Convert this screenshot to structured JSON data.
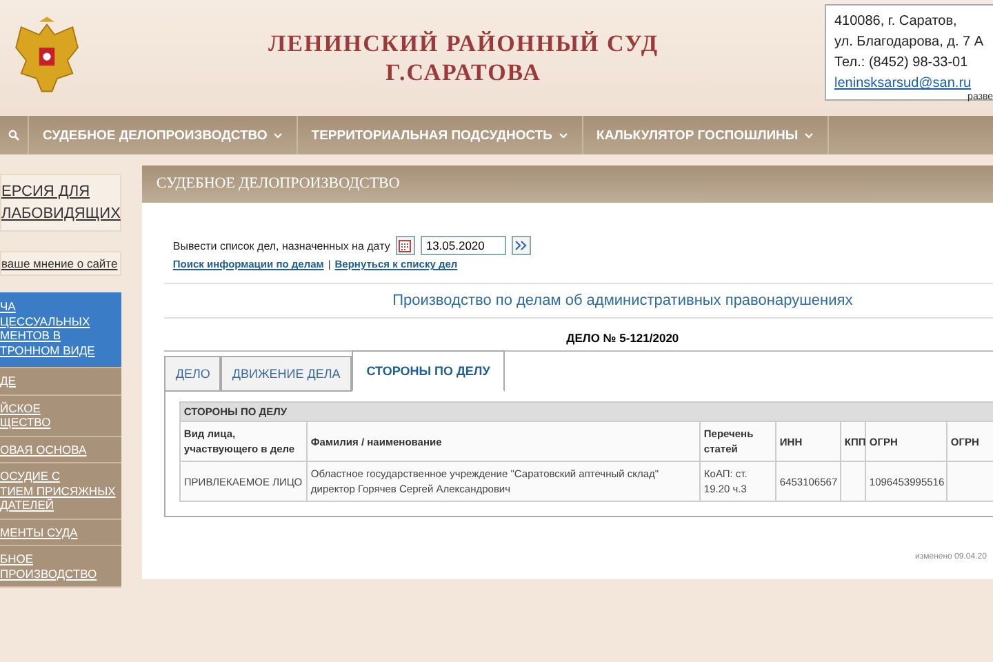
{
  "header": {
    "title_lines": [
      "ЛЕНИНСКИЙ РАЙОННЫЙ СУД",
      "Г.САРАТОВА"
    ],
    "contacts": [
      "410086, г. Саратов,",
      "ул. Благодарова, д. 7 А",
      "Тел.: (8452) 98-33-01"
    ],
    "email": "leninsksarsud@san.ru",
    "expand_hint": "разве"
  },
  "nav": {
    "items": [
      {
        "label": "СУДЕБНОЕ ДЕЛОПРОИЗВОДСТВО"
      },
      {
        "label": "ТЕРРИТОРИАЛЬНАЯ ПОДСУДНОСТЬ"
      },
      {
        "label": "КАЛЬКУЛЯТОР ГОСПОШЛИНЫ"
      }
    ]
  },
  "sidebar": {
    "accessibility_lines": [
      "ЕРСИЯ ДЛЯ",
      "ЛАБОВИДЯЩИХ"
    ],
    "feedback": "ваше мнение о сайте",
    "items": [
      {
        "lines": [
          "ЧА",
          "ЦЕССУАЛЬНЫХ",
          "МЕНТОВ В",
          "ТРОННОМ ВИДЕ"
        ],
        "selected": true
      },
      {
        "lines": [
          "ДЕ"
        ],
        "selected": false
      },
      {
        "lines": [
          "ЙСКОЕ",
          "ЩЕСТВО"
        ],
        "selected": false
      },
      {
        "lines": [
          "ОВАЯ ОСНОВА"
        ],
        "selected": false
      },
      {
        "lines": [
          "ОСУДИЕ С",
          "ТИЕМ ПРИСЯЖНЫХ",
          "ДАТЕЛЕЙ"
        ],
        "selected": false
      },
      {
        "lines": [
          "МЕНТЫ СУДА"
        ],
        "selected": false
      },
      {
        "lines": [
          "БНОЕ",
          "ПРОИЗВОДСТВО"
        ],
        "selected": false
      }
    ]
  },
  "panel": {
    "title": "СУДЕБНОЕ ДЕЛОПРОИЗВОДСТВО",
    "date_label": "Вывести список дел, назначенных на дату",
    "date_value": "13.05.2020",
    "links": [
      "Поиск информации по делам",
      "Вернуться к списку дел"
    ],
    "separator": "|",
    "category": "Производство по делам об административных правонарушениях",
    "case_title": "ДЕЛО № 5-121/2020",
    "tabs": [
      {
        "label": "ДЕЛО",
        "selected": false
      },
      {
        "label": "ДВИЖЕНИЕ ДЕЛА",
        "selected": false
      },
      {
        "label": "СТОРОНЫ ПО ДЕЛУ",
        "selected": true
      }
    ],
    "table": {
      "caption": "СТОРОНЫ ПО ДЕЛУ",
      "columns": [
        "Вид лица, участвующего в деле",
        "Фамилия / наименование",
        "Перечень статей",
        "ИНН",
        "КПП",
        "ОГРН",
        "ОГРН"
      ],
      "rows": [
        [
          "ПРИВЛЕКАЕМОЕ ЛИЦО",
          "Областное государственное учреждение \"Саратовский аптечный склад\" директор Горячев Сергей Александрович",
          "КоАП: ст. 19.20 ч.3",
          "6453106567",
          "",
          "1096453995516",
          ""
        ]
      ]
    },
    "modified": "изменено 09.04.20"
  }
}
